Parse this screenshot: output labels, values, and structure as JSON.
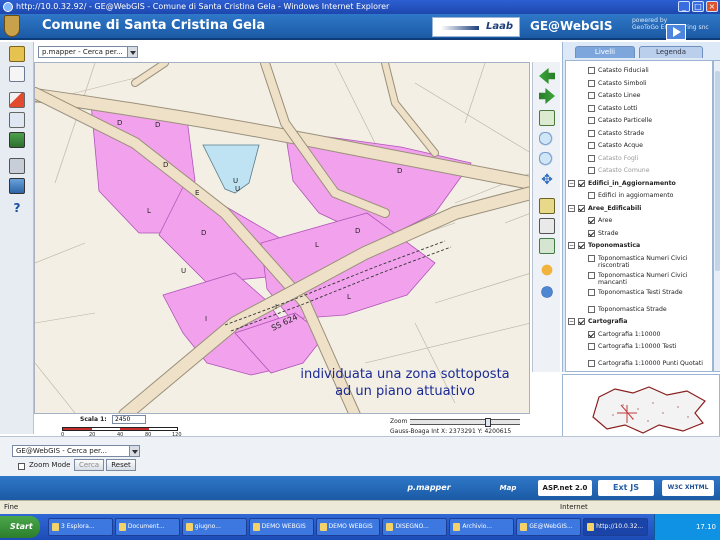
{
  "window": {
    "title": "http://10.0.32.92/ - GE@WebGIS - Comune di Santa Cristina Gela - Windows Internet Explorer",
    "buttons": [
      "_",
      "□",
      "×"
    ]
  },
  "header": {
    "app_title": "Comune di Santa Cristina Gela",
    "vendor_logo": "Laab",
    "product_name": "GE@WebGIS",
    "powered_by_line1": "powered by",
    "powered_by_line2": "GeoToGo Engineering snc"
  },
  "map_toolbar": {
    "theme_select_value": "p.mapper - Cerca per..."
  },
  "map": {
    "annotation_line1": "individuata una zona sottoposta",
    "annotation_line2": "ad un piano attuativo",
    "parcel_labels": [
      "D",
      "D",
      "E",
      "D",
      "D",
      "U",
      "U",
      "L",
      "U",
      "L",
      "D",
      "D",
      "I",
      "I",
      "L"
    ],
    "road_label": "SS 624",
    "colors": {
      "background": "#f3efe4",
      "zone": "#f2a2ec",
      "zone_stroke": "#b054b8",
      "water": "#bfe3f2",
      "road": "#eee1c8",
      "road_edge": "#9a8f7a"
    }
  },
  "scale": {
    "label": "Scala 1:",
    "value": "2450",
    "ticks": [
      "0",
      "20",
      "40",
      "80",
      "120"
    ]
  },
  "zoom": {
    "label": "Zoom",
    "level": 0.72
  },
  "coords": {
    "text": "Gauss-Boaga Int   X: 2373291   Y: 4200615"
  },
  "search": {
    "select_value": "GE@WebGIS - Cerca per...",
    "zoom_mode_label": "Zoom Mode",
    "cerca_button": "Cerca",
    "reset_button": "Reset"
  },
  "layers_panel": {
    "tabs": [
      {
        "label": "Livelli",
        "active": true
      },
      {
        "label": "Legenda",
        "active": false
      }
    ],
    "rows": [
      {
        "text": "Catasto Fiduciali",
        "checked": false,
        "group": false,
        "greyed": false
      },
      {
        "text": "Catasto Simboli",
        "checked": false,
        "group": false,
        "greyed": false
      },
      {
        "text": "Catasto Linee",
        "checked": false,
        "group": false,
        "greyed": false
      },
      {
        "text": "Catasto Lotti",
        "checked": false,
        "group": false,
        "greyed": false
      },
      {
        "text": "Catasto Particelle",
        "checked": false,
        "group": false,
        "greyed": false
      },
      {
        "text": "Catasto Strade",
        "checked": false,
        "group": false,
        "greyed": false
      },
      {
        "text": "Catasto Acque",
        "checked": false,
        "group": false,
        "greyed": false
      },
      {
        "text": "Catasto Fogli",
        "checked": false,
        "group": false,
        "greyed": true
      },
      {
        "text": "Catasto Comune",
        "checked": false,
        "group": false,
        "greyed": true
      },
      {
        "text": "Edifici_in_Aggiornamento",
        "checked": true,
        "group": true,
        "greyed": false
      },
      {
        "text": "Edifici in aggiornamento",
        "checked": false,
        "group": false,
        "greyed": false
      },
      {
        "text": "Aree_Edificabili",
        "checked": true,
        "group": true,
        "greyed": false
      },
      {
        "text": "Aree",
        "checked": true,
        "group": false,
        "greyed": false
      },
      {
        "text": "Strade",
        "checked": true,
        "group": false,
        "greyed": false
      },
      {
        "text": "Toponomastica",
        "checked": true,
        "group": true,
        "greyed": false
      },
      {
        "text": "Toponomastica Numeri Civici riscontrati",
        "checked": false,
        "group": false,
        "greyed": false
      },
      {
        "text": "Toponomastica Numeri Civici mancanti",
        "checked": false,
        "group": false,
        "greyed": false
      },
      {
        "text": "Toponomastica Testi Strade",
        "checked": false,
        "group": false,
        "greyed": false
      },
      {
        "text": "Toponomastica Strade",
        "checked": false,
        "group": false,
        "greyed": false
      },
      {
        "text": "Cartografia",
        "checked": true,
        "group": true,
        "greyed": false
      },
      {
        "text": "Cartografia 1:10000",
        "checked": true,
        "group": false,
        "greyed": false
      },
      {
        "text": "Cartografia 1:10000 Testi",
        "checked": false,
        "group": false,
        "greyed": false
      },
      {
        "text": "Cartografia 1:10000 Punti Quotati",
        "checked": false,
        "group": false,
        "greyed": false
      }
    ]
  },
  "footer": {
    "logos": [
      "p.mapper",
      "Map Server",
      "ASP.net 2.0",
      "Ext JS",
      "W3C XHTML 1.0"
    ]
  },
  "statusbar": {
    "left_text": "Fine",
    "zone_text": "Internet"
  },
  "taskbar": {
    "start_label": "Start",
    "items": [
      "3 Esplora...",
      "Document...",
      "giugno...",
      "DEMO WEBGIS",
      "DEMO WEBGIS",
      "DISEGNO...",
      "Archivio...",
      "GE@WebGIS...",
      "http://10.0.32..."
    ],
    "clock": "17.10"
  }
}
